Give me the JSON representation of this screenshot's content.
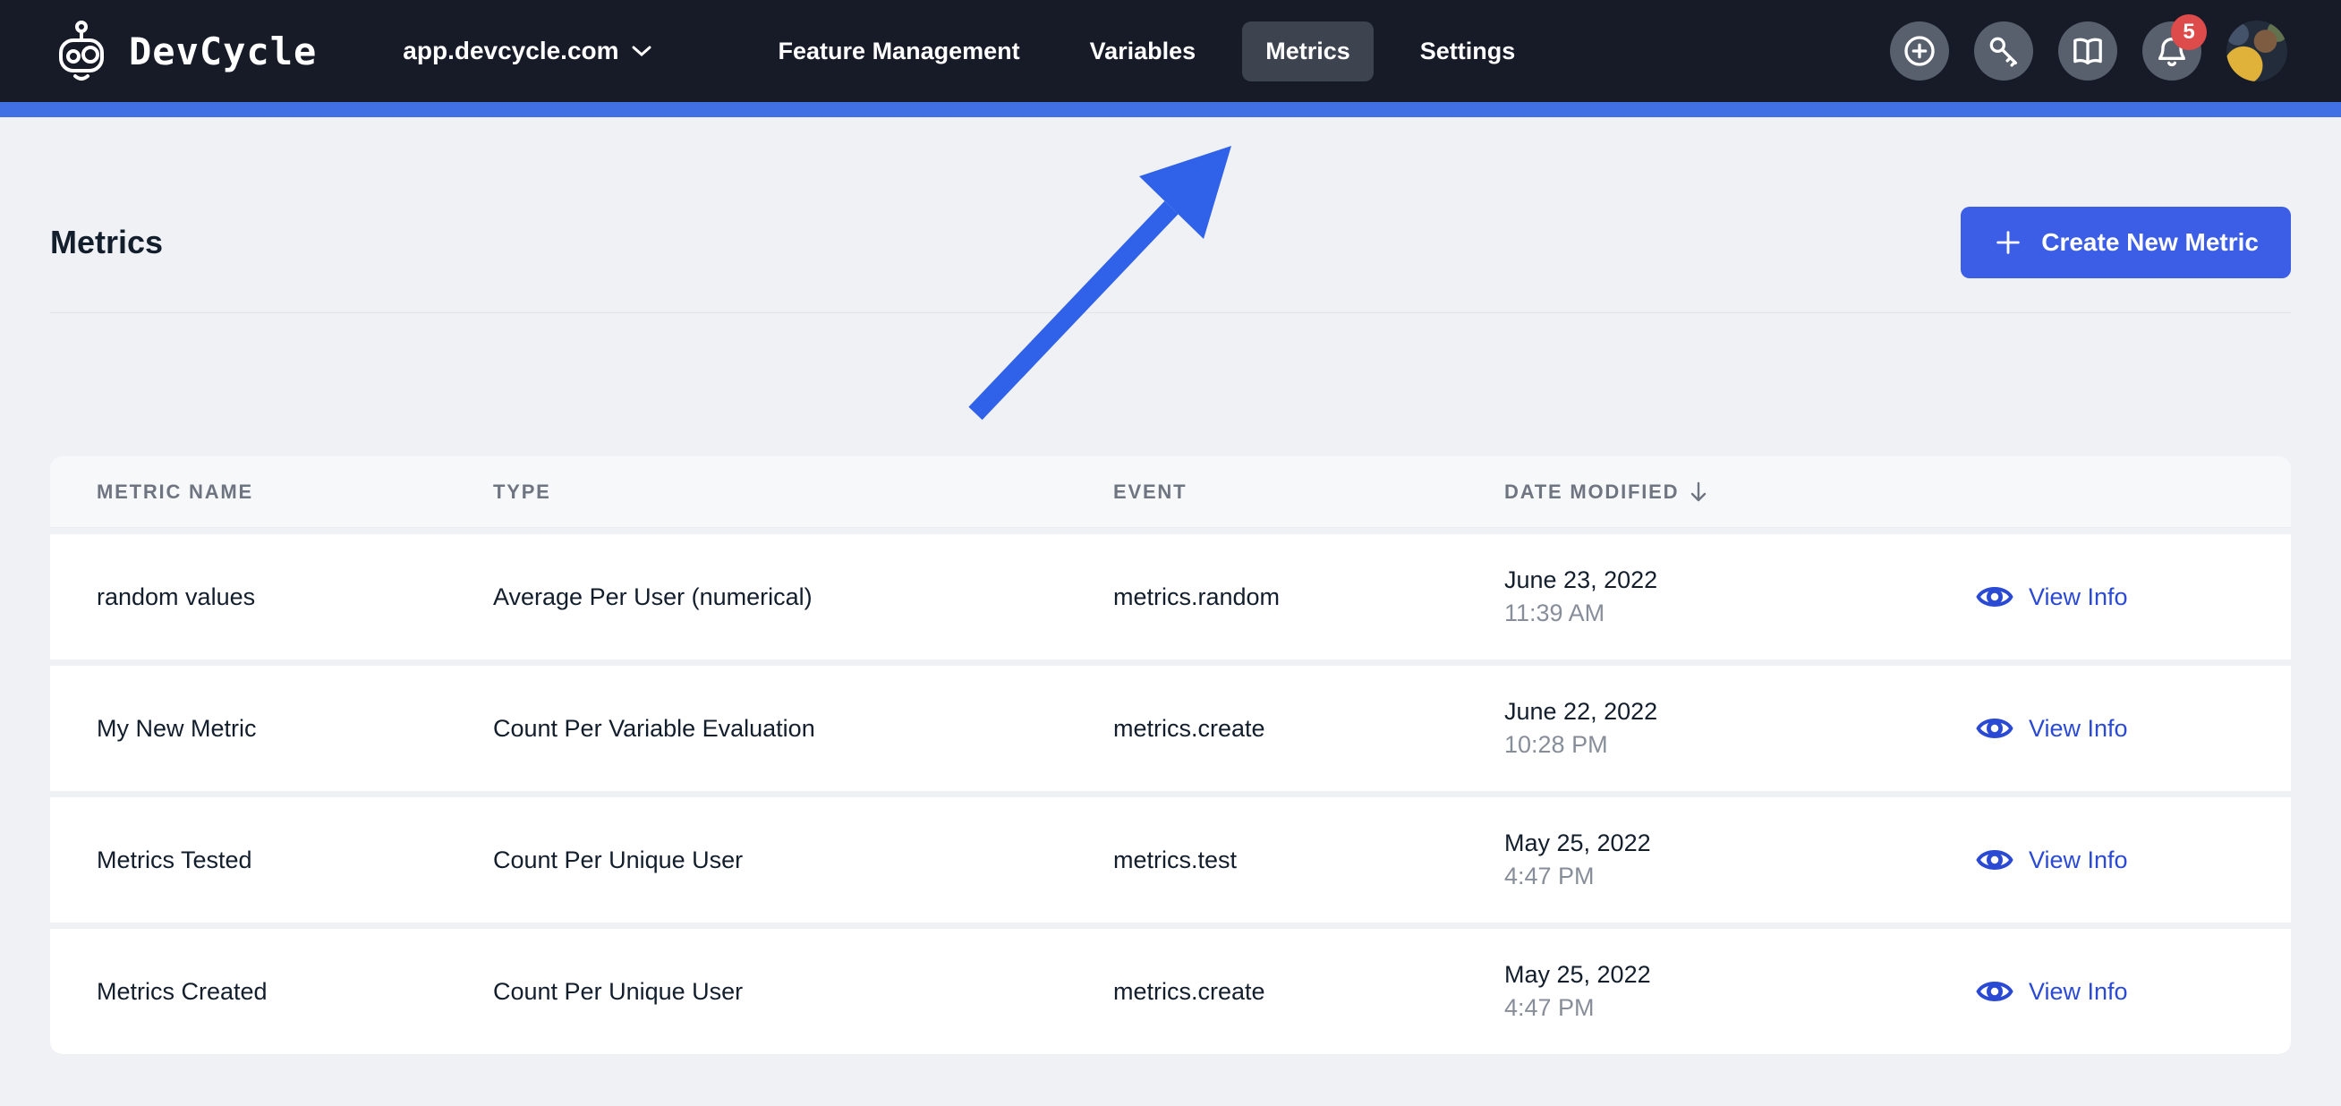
{
  "nav": {
    "brand": "DevCycle",
    "org_selector": "app.devcycle.com",
    "items": [
      {
        "label": "Feature Management",
        "active": false
      },
      {
        "label": "Variables",
        "active": false
      },
      {
        "label": "Metrics",
        "active": true
      },
      {
        "label": "Settings",
        "active": false
      }
    ],
    "action_icons": [
      "plus-circle-icon",
      "key-icon",
      "book-icon",
      "bell-icon",
      "avatar"
    ],
    "notification_count": "5"
  },
  "page": {
    "title": "Metrics",
    "create_button_label": "Create New Metric"
  },
  "table": {
    "columns": [
      "METRIC NAME",
      "TYPE",
      "EVENT",
      "DATE MODIFIED"
    ],
    "sorted_column": "DATE MODIFIED",
    "sort_direction": "descending",
    "rows": [
      {
        "name": "random values",
        "type": "Average Per User (numerical)",
        "event": "metrics.random",
        "date": "June 23, 2022",
        "time": "11:39 AM",
        "action": "View Info"
      },
      {
        "name": "My New Metric",
        "type": "Count Per Variable Evaluation",
        "event": "metrics.create",
        "date": "June 22, 2022",
        "time": "10:28 PM",
        "action": "View Info"
      },
      {
        "name": "Metrics Tested",
        "type": "Count Per Unique User",
        "event": "metrics.test",
        "date": "May 25, 2022",
        "time": "4:47 PM",
        "action": "View Info"
      },
      {
        "name": "Metrics Created",
        "type": "Count Per Unique User",
        "event": "metrics.create",
        "date": "May 25, 2022",
        "time": "4:47 PM",
        "action": "View Info"
      }
    ]
  },
  "colors": {
    "nav_bg": "#161b27",
    "accent_bar": "#4170e5",
    "button_blue": "#3c5ee6",
    "link_blue": "#2b4ad3",
    "arrow_blue": "#2f62e8",
    "badge_red": "#dd4b4b",
    "page_bg": "#f0f1f4"
  }
}
